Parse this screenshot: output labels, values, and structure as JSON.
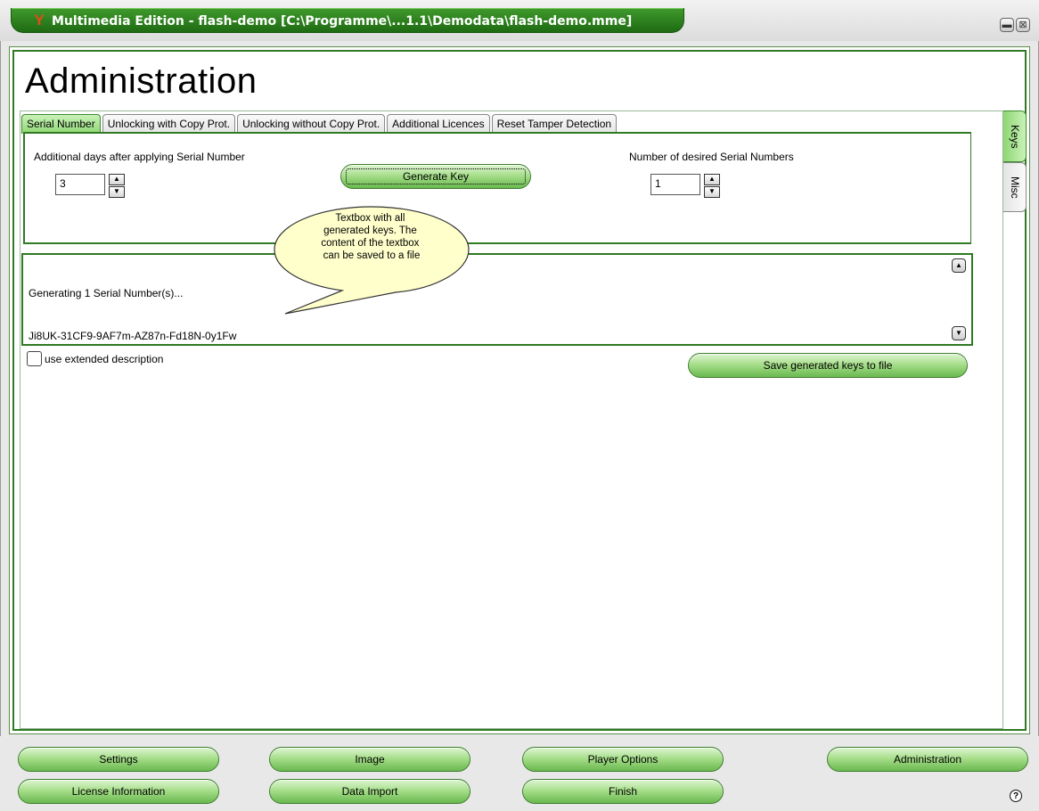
{
  "window": {
    "title": "Multimedia Edition - flash-demo [C:\\Programme\\...1.1\\Demodata\\flash-demo.mme]",
    "minimize_glyph": "▬",
    "close_glyph": "⊠"
  },
  "page": {
    "title": "Administration"
  },
  "tabs": [
    {
      "label": "Serial Number",
      "active": true
    },
    {
      "label": "Unlocking with Copy Prot.",
      "active": false
    },
    {
      "label": "Unlocking without Copy Prot.",
      "active": false
    },
    {
      "label": "Additional Licences",
      "active": false
    },
    {
      "label": "Reset Tamper Detection",
      "active": false
    }
  ],
  "side_tabs": [
    {
      "label": "Keys",
      "active": true
    },
    {
      "label": "Misc",
      "active": false
    }
  ],
  "serial": {
    "days_label": "Additional days after applying Serial Number",
    "days_value": "3",
    "generate_label": "Generate Key",
    "count_label": "Number of desired Serial Numbers",
    "count_value": "1"
  },
  "output": {
    "line1": "Generating 1 Serial Number(s)...",
    "line2": "Ji8UK-31CF9-9AF7m-AZ87n-Fd18N-0y1Fw"
  },
  "callout": {
    "line1": "Textbox with all",
    "line2": "generated keys. The",
    "line3": "content of the textbox",
    "line4": "can be saved to a file"
  },
  "options": {
    "extended_label": "use extended description",
    "save_label": "Save generated keys to file"
  },
  "nav": {
    "settings": "Settings",
    "image": "Image",
    "player_options": "Player Options",
    "administration": "Administration",
    "license_information": "License Information",
    "data_import": "Data Import",
    "finish": "Finish"
  },
  "icons": {
    "app": "app-logo-icon",
    "help": "help-icon"
  },
  "colors": {
    "accent_green": "#2f7a23",
    "button_green": "#a8df8c",
    "title_green": "#1f6b13"
  }
}
